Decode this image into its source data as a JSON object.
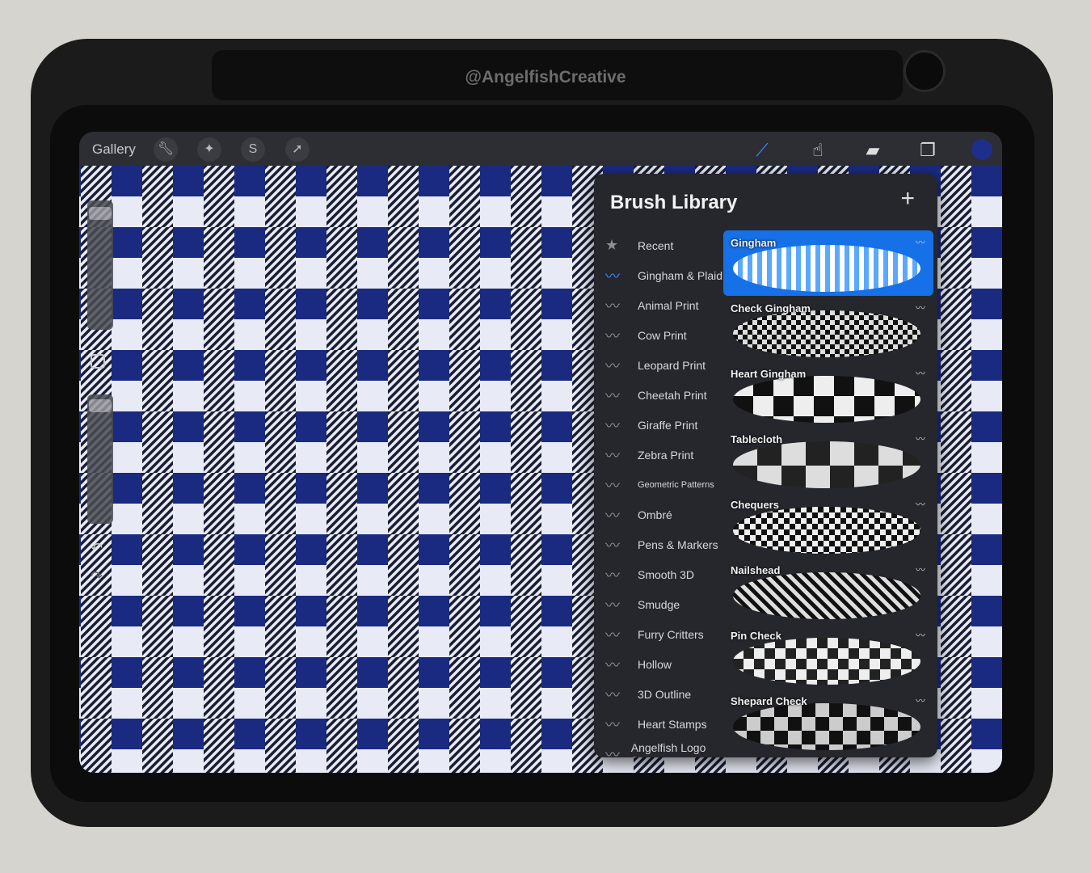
{
  "watermark": "@Angelfish​Creative",
  "toolbar": {
    "gallery": "Gallery",
    "left_icons": [
      "wrench-icon",
      "magic-wand-icon",
      "selection-icon",
      "move-arrow-icon"
    ],
    "right_icons": [
      "brush-icon",
      "smudge-icon",
      "eraser-icon",
      "layers-icon"
    ],
    "color": "#1d2f8a"
  },
  "canvas": {
    "blue": "#1a2a80",
    "white": "#e8ebf5"
  },
  "brush_library": {
    "title": "Brush Library",
    "add": "+",
    "sets": [
      {
        "label": "Recent",
        "icon": "star-icon"
      },
      {
        "label": "Gingham & Plaid",
        "active": true
      },
      {
        "label": "Animal Print"
      },
      {
        "label": "Cow Print"
      },
      {
        "label": "Leopard Print"
      },
      {
        "label": "Cheetah Print"
      },
      {
        "label": "Giraffe Print"
      },
      {
        "label": "Zebra Print"
      },
      {
        "label": "Geometric Patterns"
      },
      {
        "label": "Ombré"
      },
      {
        "label": "Pens & Markers"
      },
      {
        "label": "Smooth 3D"
      },
      {
        "label": "Smudge"
      },
      {
        "label": "Furry Critters"
      },
      {
        "label": "Hollow"
      },
      {
        "label": "3D Outline"
      },
      {
        "label": "Heart Stamps"
      },
      {
        "label": "Angelfish Logo Stamps"
      }
    ],
    "brushes": [
      {
        "name": "Gingham",
        "active": true
      },
      {
        "name": "Check Gingham"
      },
      {
        "name": "Heart Gingham"
      },
      {
        "name": "Tablecloth"
      },
      {
        "name": "Chequers"
      },
      {
        "name": "Nailshead"
      },
      {
        "name": "Pin Check"
      },
      {
        "name": "Shepard Check"
      }
    ],
    "accent": "#1670e8"
  }
}
